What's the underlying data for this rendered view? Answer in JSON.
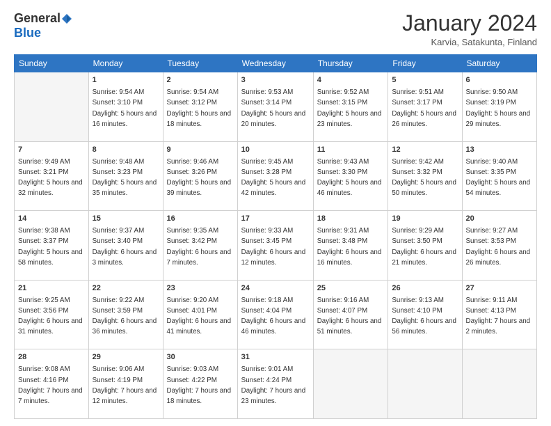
{
  "header": {
    "logo_general": "General",
    "logo_blue": "Blue",
    "month_title": "January 2024",
    "location": "Karvia, Satakunta, Finland"
  },
  "days_of_week": [
    "Sunday",
    "Monday",
    "Tuesday",
    "Wednesday",
    "Thursday",
    "Friday",
    "Saturday"
  ],
  "weeks": [
    [
      {
        "num": "",
        "sunrise": "",
        "sunset": "",
        "daylight": ""
      },
      {
        "num": "1",
        "sunrise": "Sunrise: 9:54 AM",
        "sunset": "Sunset: 3:10 PM",
        "daylight": "Daylight: 5 hours and 16 minutes."
      },
      {
        "num": "2",
        "sunrise": "Sunrise: 9:54 AM",
        "sunset": "Sunset: 3:12 PM",
        "daylight": "Daylight: 5 hours and 18 minutes."
      },
      {
        "num": "3",
        "sunrise": "Sunrise: 9:53 AM",
        "sunset": "Sunset: 3:14 PM",
        "daylight": "Daylight: 5 hours and 20 minutes."
      },
      {
        "num": "4",
        "sunrise": "Sunrise: 9:52 AM",
        "sunset": "Sunset: 3:15 PM",
        "daylight": "Daylight: 5 hours and 23 minutes."
      },
      {
        "num": "5",
        "sunrise": "Sunrise: 9:51 AM",
        "sunset": "Sunset: 3:17 PM",
        "daylight": "Daylight: 5 hours and 26 minutes."
      },
      {
        "num": "6",
        "sunrise": "Sunrise: 9:50 AM",
        "sunset": "Sunset: 3:19 PM",
        "daylight": "Daylight: 5 hours and 29 minutes."
      }
    ],
    [
      {
        "num": "7",
        "sunrise": "Sunrise: 9:49 AM",
        "sunset": "Sunset: 3:21 PM",
        "daylight": "Daylight: 5 hours and 32 minutes."
      },
      {
        "num": "8",
        "sunrise": "Sunrise: 9:48 AM",
        "sunset": "Sunset: 3:23 PM",
        "daylight": "Daylight: 5 hours and 35 minutes."
      },
      {
        "num": "9",
        "sunrise": "Sunrise: 9:46 AM",
        "sunset": "Sunset: 3:26 PM",
        "daylight": "Daylight: 5 hours and 39 minutes."
      },
      {
        "num": "10",
        "sunrise": "Sunrise: 9:45 AM",
        "sunset": "Sunset: 3:28 PM",
        "daylight": "Daylight: 5 hours and 42 minutes."
      },
      {
        "num": "11",
        "sunrise": "Sunrise: 9:43 AM",
        "sunset": "Sunset: 3:30 PM",
        "daylight": "Daylight: 5 hours and 46 minutes."
      },
      {
        "num": "12",
        "sunrise": "Sunrise: 9:42 AM",
        "sunset": "Sunset: 3:32 PM",
        "daylight": "Daylight: 5 hours and 50 minutes."
      },
      {
        "num": "13",
        "sunrise": "Sunrise: 9:40 AM",
        "sunset": "Sunset: 3:35 PM",
        "daylight": "Daylight: 5 hours and 54 minutes."
      }
    ],
    [
      {
        "num": "14",
        "sunrise": "Sunrise: 9:38 AM",
        "sunset": "Sunset: 3:37 PM",
        "daylight": "Daylight: 5 hours and 58 minutes."
      },
      {
        "num": "15",
        "sunrise": "Sunrise: 9:37 AM",
        "sunset": "Sunset: 3:40 PM",
        "daylight": "Daylight: 6 hours and 3 minutes."
      },
      {
        "num": "16",
        "sunrise": "Sunrise: 9:35 AM",
        "sunset": "Sunset: 3:42 PM",
        "daylight": "Daylight: 6 hours and 7 minutes."
      },
      {
        "num": "17",
        "sunrise": "Sunrise: 9:33 AM",
        "sunset": "Sunset: 3:45 PM",
        "daylight": "Daylight: 6 hours and 12 minutes."
      },
      {
        "num": "18",
        "sunrise": "Sunrise: 9:31 AM",
        "sunset": "Sunset: 3:48 PM",
        "daylight": "Daylight: 6 hours and 16 minutes."
      },
      {
        "num": "19",
        "sunrise": "Sunrise: 9:29 AM",
        "sunset": "Sunset: 3:50 PM",
        "daylight": "Daylight: 6 hours and 21 minutes."
      },
      {
        "num": "20",
        "sunrise": "Sunrise: 9:27 AM",
        "sunset": "Sunset: 3:53 PM",
        "daylight": "Daylight: 6 hours and 26 minutes."
      }
    ],
    [
      {
        "num": "21",
        "sunrise": "Sunrise: 9:25 AM",
        "sunset": "Sunset: 3:56 PM",
        "daylight": "Daylight: 6 hours and 31 minutes."
      },
      {
        "num": "22",
        "sunrise": "Sunrise: 9:22 AM",
        "sunset": "Sunset: 3:59 PM",
        "daylight": "Daylight: 6 hours and 36 minutes."
      },
      {
        "num": "23",
        "sunrise": "Sunrise: 9:20 AM",
        "sunset": "Sunset: 4:01 PM",
        "daylight": "Daylight: 6 hours and 41 minutes."
      },
      {
        "num": "24",
        "sunrise": "Sunrise: 9:18 AM",
        "sunset": "Sunset: 4:04 PM",
        "daylight": "Daylight: 6 hours and 46 minutes."
      },
      {
        "num": "25",
        "sunrise": "Sunrise: 9:16 AM",
        "sunset": "Sunset: 4:07 PM",
        "daylight": "Daylight: 6 hours and 51 minutes."
      },
      {
        "num": "26",
        "sunrise": "Sunrise: 9:13 AM",
        "sunset": "Sunset: 4:10 PM",
        "daylight": "Daylight: 6 hours and 56 minutes."
      },
      {
        "num": "27",
        "sunrise": "Sunrise: 9:11 AM",
        "sunset": "Sunset: 4:13 PM",
        "daylight": "Daylight: 7 hours and 2 minutes."
      }
    ],
    [
      {
        "num": "28",
        "sunrise": "Sunrise: 9:08 AM",
        "sunset": "Sunset: 4:16 PM",
        "daylight": "Daylight: 7 hours and 7 minutes."
      },
      {
        "num": "29",
        "sunrise": "Sunrise: 9:06 AM",
        "sunset": "Sunset: 4:19 PM",
        "daylight": "Daylight: 7 hours and 12 minutes."
      },
      {
        "num": "30",
        "sunrise": "Sunrise: 9:03 AM",
        "sunset": "Sunset: 4:22 PM",
        "daylight": "Daylight: 7 hours and 18 minutes."
      },
      {
        "num": "31",
        "sunrise": "Sunrise: 9:01 AM",
        "sunset": "Sunset: 4:24 PM",
        "daylight": "Daylight: 7 hours and 23 minutes."
      },
      {
        "num": "",
        "sunrise": "",
        "sunset": "",
        "daylight": ""
      },
      {
        "num": "",
        "sunrise": "",
        "sunset": "",
        "daylight": ""
      },
      {
        "num": "",
        "sunrise": "",
        "sunset": "",
        "daylight": ""
      }
    ]
  ]
}
